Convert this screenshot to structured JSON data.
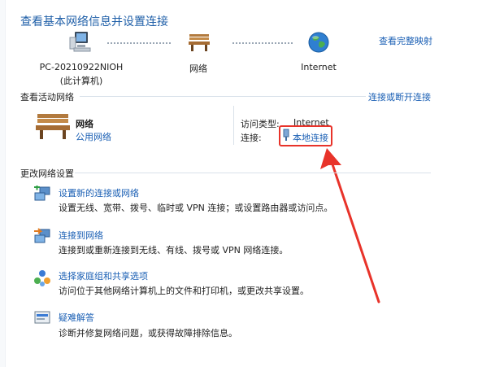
{
  "header": {
    "title": "查看基本网络信息并设置连接",
    "view_full_map": "查看完整映射"
  },
  "map": {
    "computer_name": "PC-20210922NIOH",
    "computer_sub": "(此计算机)",
    "network_label": "网络",
    "internet_label": "Internet"
  },
  "active": {
    "section_title": "查看活动网络",
    "connect_disconnect": "连接或断开连接",
    "network_name": "网络",
    "network_type": "公用网络",
    "access_type_label": "访问类型:",
    "access_type_value": "Internet",
    "connection_label": "连接:",
    "connection_value": "本地连接"
  },
  "settings": {
    "section_title": "更改网络设置",
    "items": [
      {
        "title": "设置新的连接或网络",
        "desc": "设置无线、宽带、拨号、临时或 VPN 连接；或设置路由器或访问点。"
      },
      {
        "title": "连接到网络",
        "desc": "连接到或重新连接到无线、有线、拨号或 VPN 网络连接。"
      },
      {
        "title": "选择家庭组和共享选项",
        "desc": "访问位于其他网络计算机上的文件和打印机，或更改共享设置。"
      },
      {
        "title": "疑难解答",
        "desc": "诊断并修复网络问题，或获得故障排除信息。"
      }
    ]
  },
  "annotation": {
    "color": "#e8332a"
  }
}
